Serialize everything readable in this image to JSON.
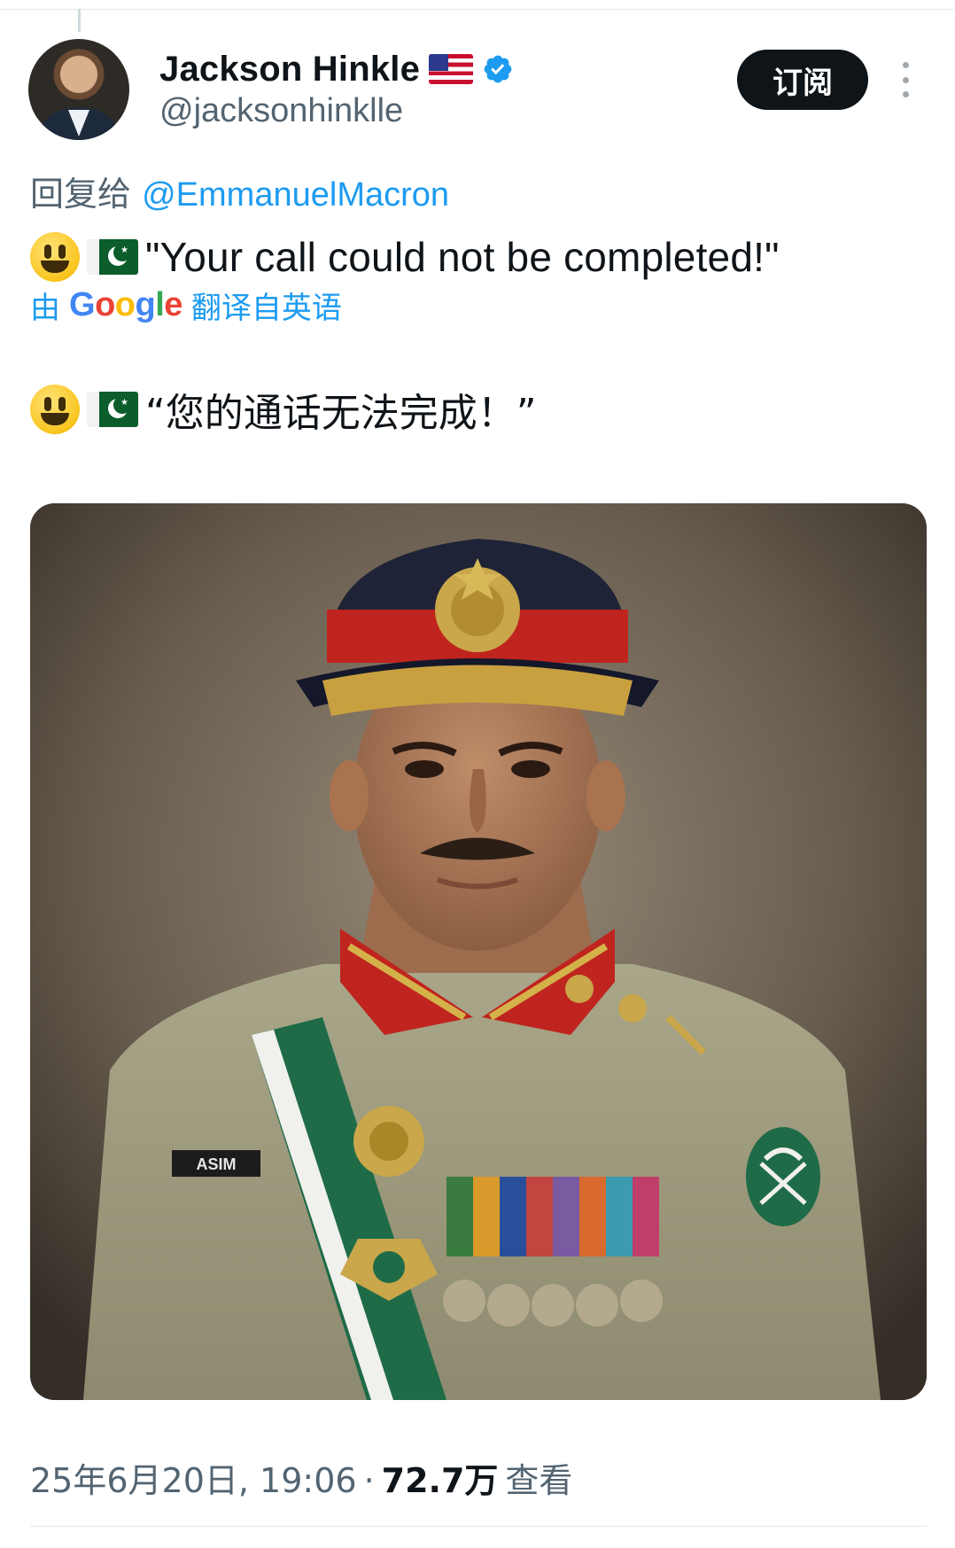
{
  "author": {
    "display_name": "Jackson Hinkle",
    "handle": "@jacksonhinklle",
    "verified": true,
    "flag_icon": "us-flag-icon"
  },
  "header": {
    "subscribe_label": "订阅",
    "more_icon": "more-vertical-icon"
  },
  "reply": {
    "prefix": "回复给",
    "mention": "@EmmanuelMacron"
  },
  "tweet": {
    "text_en": "\"Your call could not be completed!\"",
    "emojis": [
      "grinning-face-emoji",
      "pakistan-flag-emoji"
    ]
  },
  "translation": {
    "prefix": "由",
    "provider": "Google",
    "suffix": "翻译自英语",
    "text_zh": "“您的通话无法完成！”"
  },
  "media": {
    "name_tag": "ASIM"
  },
  "meta": {
    "timestamp": "25年6月20日, 19:06",
    "separator": "·",
    "views_count": "72.7万",
    "views_label": "查看"
  },
  "colors": {
    "accent": "#1d9bf0",
    "text_primary": "#0f1419",
    "text_secondary": "#536471",
    "button_bg": "#0f1419"
  }
}
